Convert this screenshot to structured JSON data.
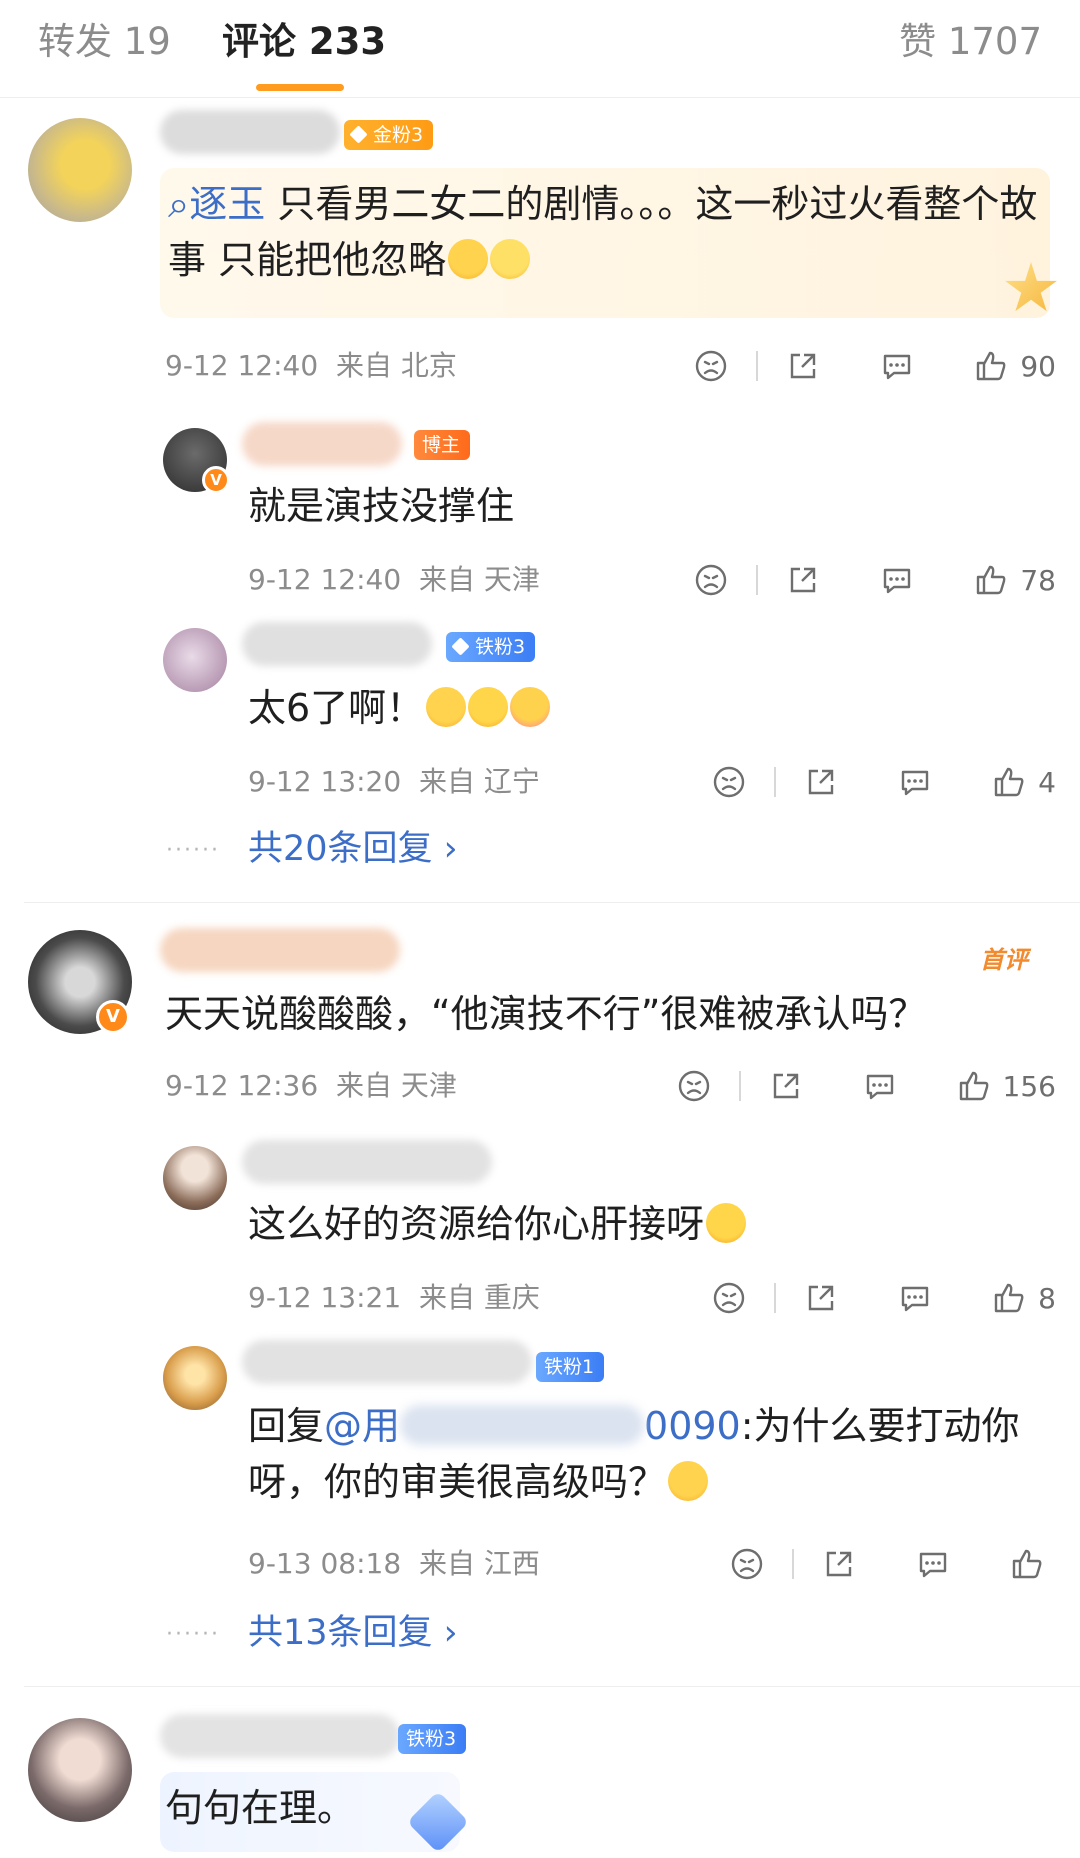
{
  "tabs": {
    "repost": "转发 19",
    "comment": "评论 233",
    "like": "赞 1707"
  },
  "comments": [
    {
      "badge": "金粉3",
      "mention": "逐玉",
      "text": " 只看男二女二的剧情。。。这一秒过火看整个故事 只能把他忽略",
      "time": "9-12 12:40",
      "location": "来自 北京",
      "likes": "90",
      "replies": [
        {
          "badge": "博主",
          "text": "就是演技没撑住",
          "time": "9-12 12:40",
          "location": "来自 天津",
          "likes": "78"
        },
        {
          "badge": "铁粉3",
          "text": "太6了啊！",
          "time": "9-12 13:20",
          "location": "来自 辽宁",
          "likes": "4"
        }
      ],
      "more_replies": "共20条回复 ›"
    },
    {
      "tag": "首评",
      "text": "天天说酸酸酸，“他演技不行”很难被承认吗？",
      "time": "9-12 12:36",
      "location": "来自 天津",
      "likes": "156",
      "replies": [
        {
          "text": "这么好的资源给你心肝接呀",
          "time": "9-12 13:21",
          "location": "来自 重庆",
          "likes": "8"
        },
        {
          "badge": "铁粉1",
          "reply_prefix": "回复",
          "mention_start": "@用",
          "mention_end": "0090",
          "text": ":为什么要打动你呀，你的审美很高级吗？",
          "time": "9-13 08:18",
          "location": "来自 江西",
          "likes": ""
        }
      ],
      "more_replies": "共13条回复 ›"
    },
    {
      "badge": "铁粉3",
      "text": "句句在理。"
    }
  ],
  "colors": {
    "accent": "#ff9c1f",
    "link": "#3c6ec8",
    "meta": "#8c8c8c"
  }
}
